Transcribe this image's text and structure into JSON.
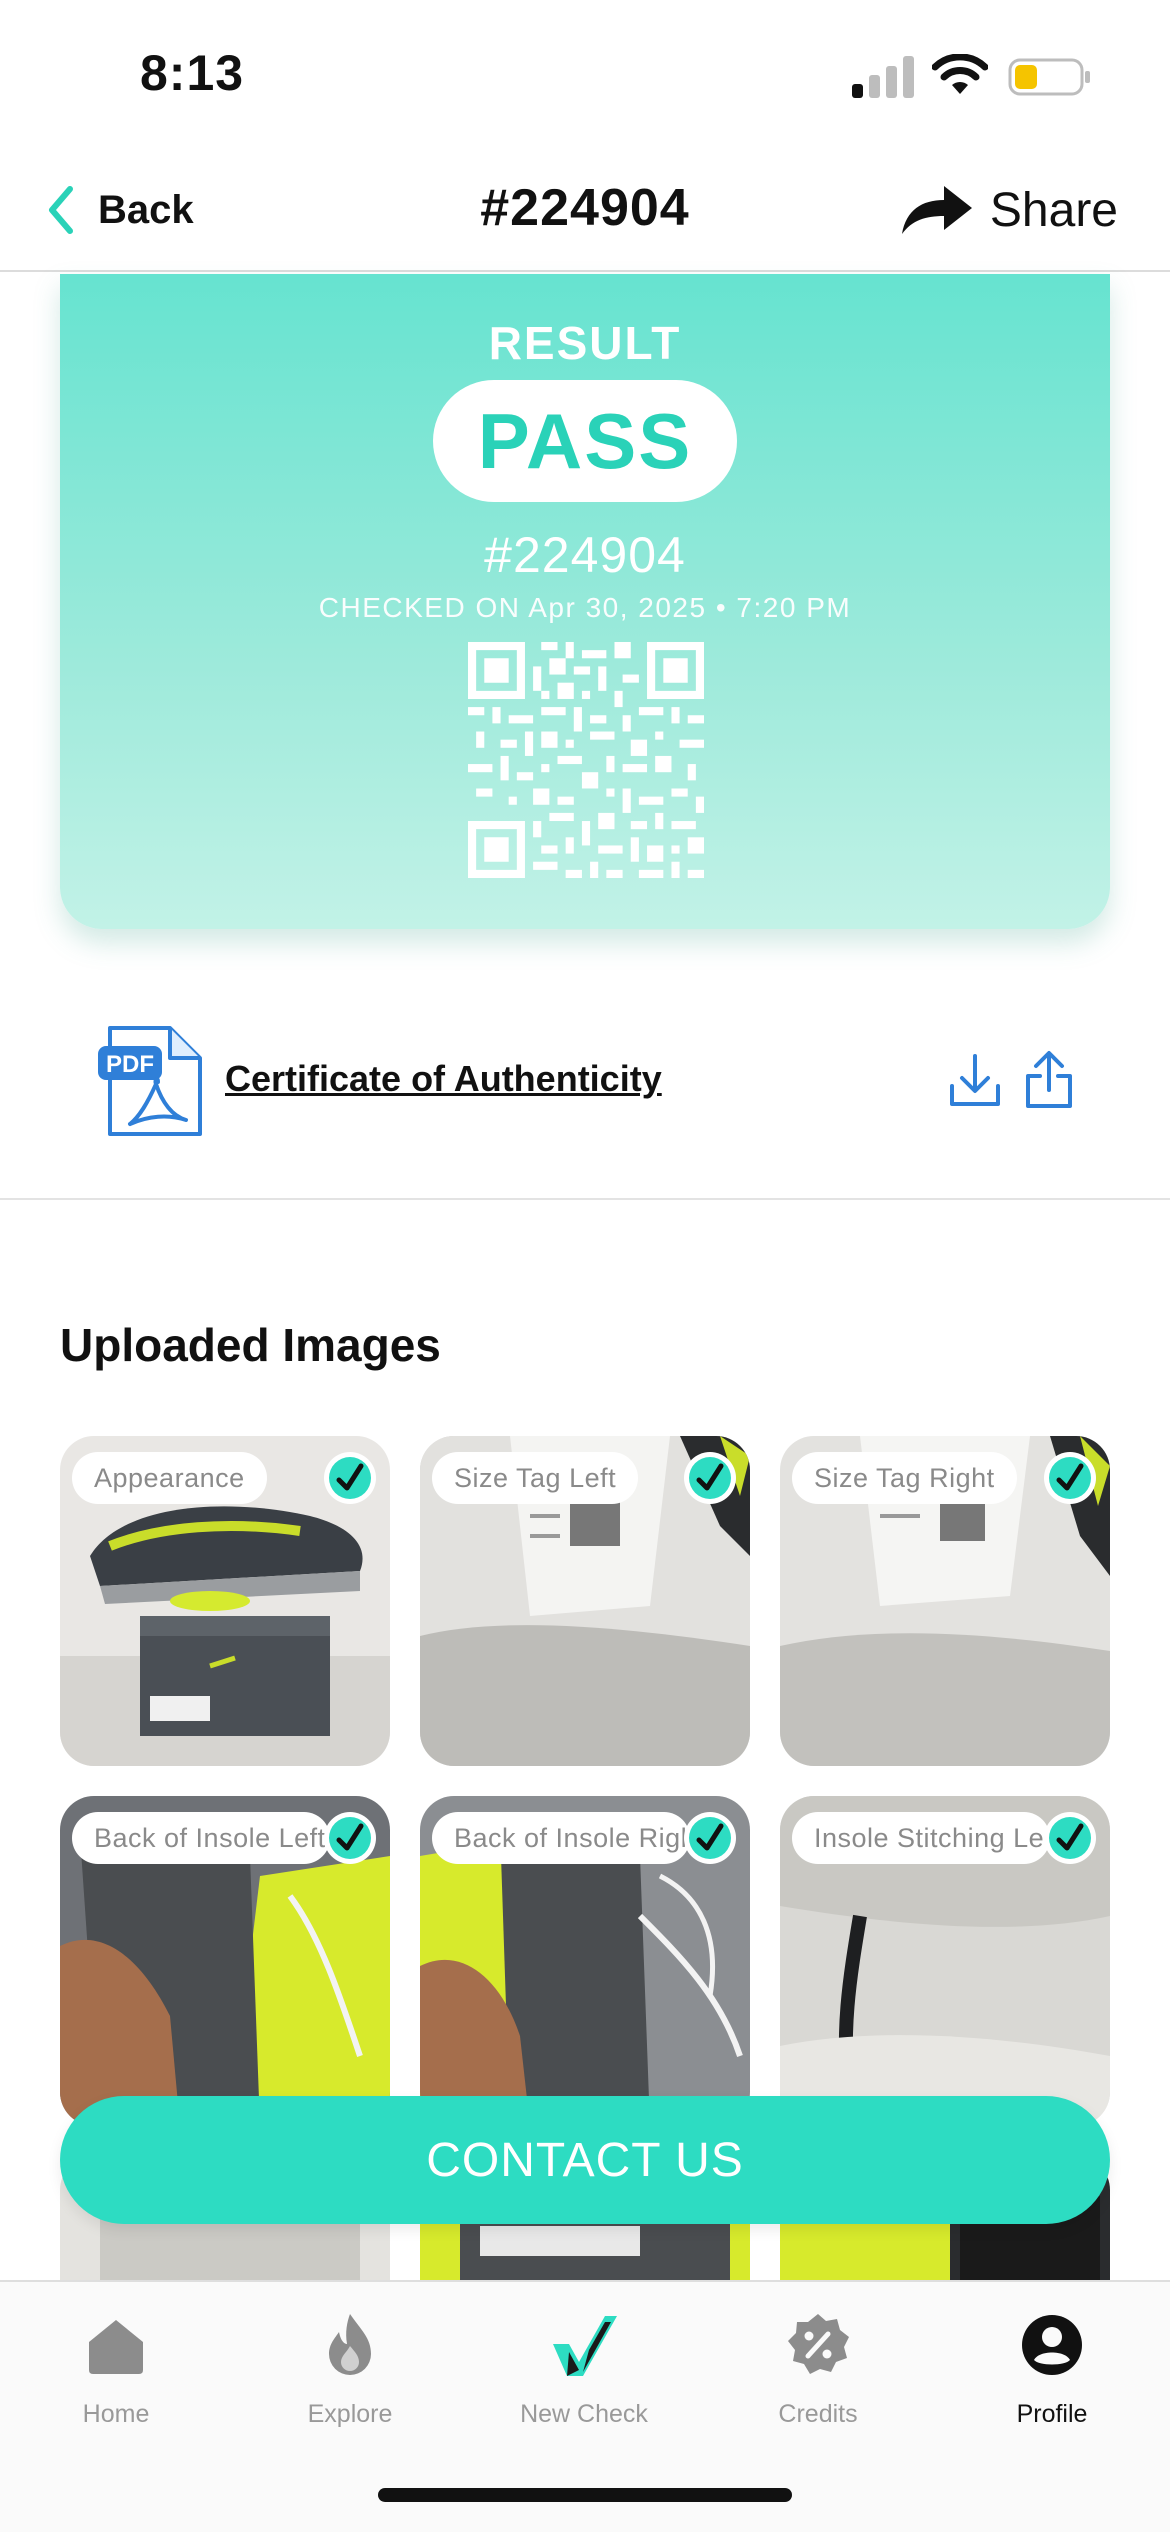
{
  "status_bar": {
    "time": "8:13"
  },
  "nav": {
    "back_label": "Back",
    "title": "#224904",
    "share_label": "Share"
  },
  "result": {
    "heading": "RESULT",
    "verdict": "PASS",
    "id": "#224904",
    "checked_on": "CHECKED ON Apr 30, 2025 • 7:20 PM"
  },
  "certificate": {
    "label": "Certificate of Authenticity",
    "pdf_badge": "PDF"
  },
  "uploaded": {
    "title": "Uploaded Images",
    "images": [
      {
        "label": "Appearance"
      },
      {
        "label": "Size Tag Left"
      },
      {
        "label": "Size Tag Right"
      },
      {
        "label": "Back of Insole Left"
      },
      {
        "label": "Back of Insole Right"
      },
      {
        "label": "Insole Stitching Left"
      }
    ]
  },
  "contact_label": "CONTACT US",
  "tabs": [
    {
      "label": "Home",
      "icon": "home-icon"
    },
    {
      "label": "Explore",
      "icon": "flame-icon"
    },
    {
      "label": "New Check",
      "icon": "checkmark-icon"
    },
    {
      "label": "Credits",
      "icon": "percent-badge-icon"
    },
    {
      "label": "Profile",
      "icon": "profile-icon",
      "active": true
    }
  ],
  "colors": {
    "accent": "#2ddcc2",
    "pass_text": "#2ad2b8",
    "link_blue": "#2f7fd8"
  }
}
